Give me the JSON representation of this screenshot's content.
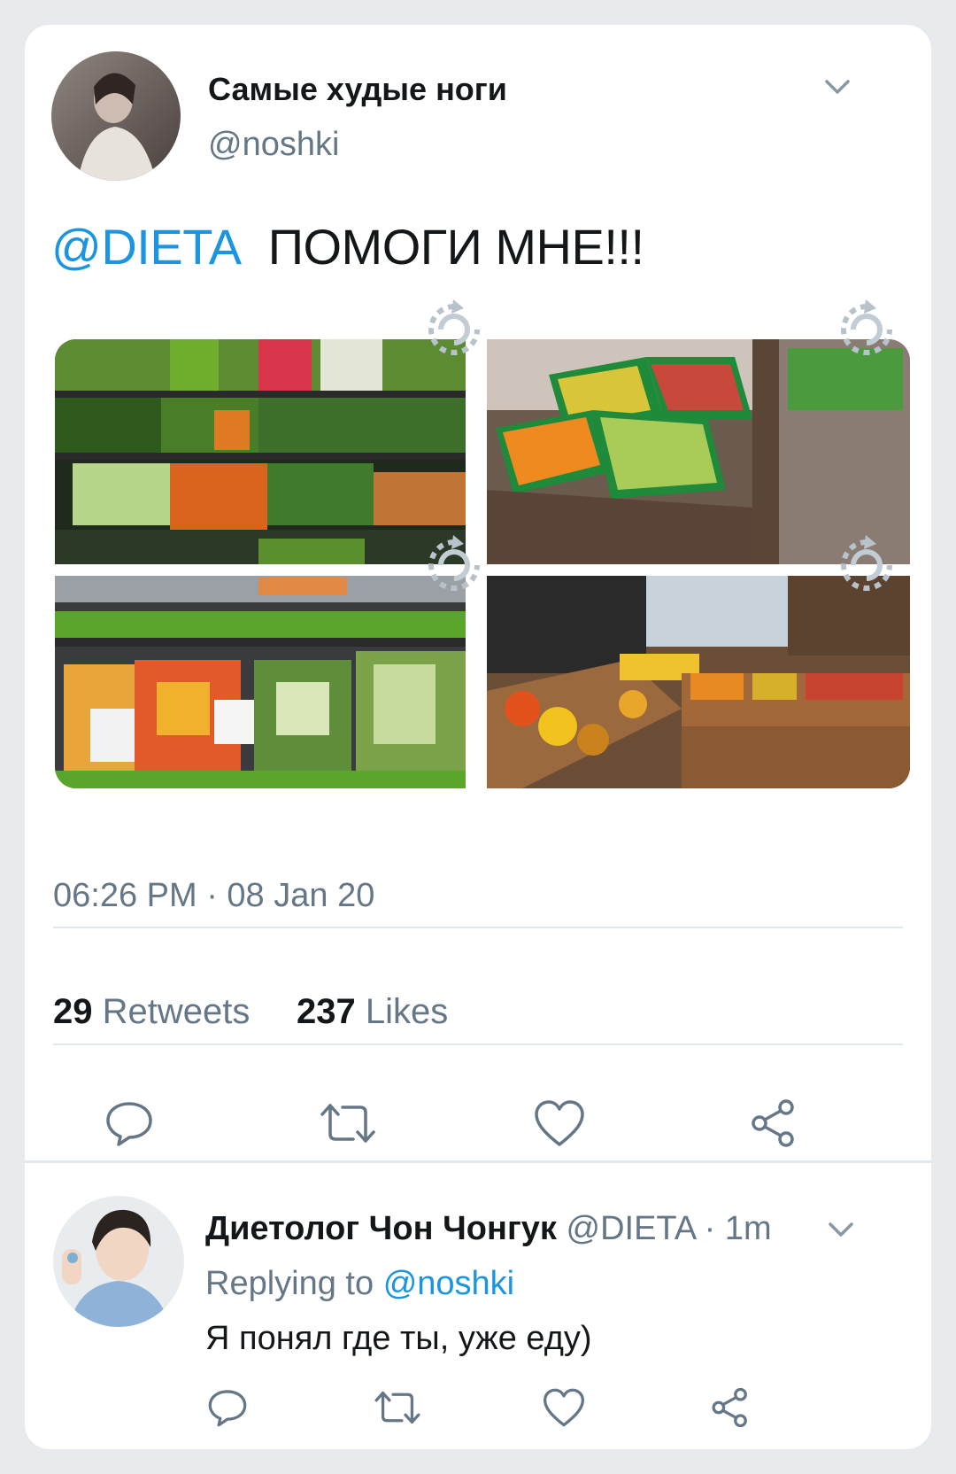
{
  "tweet": {
    "display_name": "Самые худые ноги",
    "handle": "@noshki",
    "mention": "@DIETA",
    "text": "ПОМОГИ МНЕ!!!",
    "timestamp": "06:26 PM · 08 Jan 20",
    "retweets_count": "29",
    "retweets_label": "Retweets",
    "likes_count": "237",
    "likes_label": "Likes",
    "photos": [
      {
        "name": "produce-shelf-photo"
      },
      {
        "name": "fruit-crates-photo"
      },
      {
        "name": "packaged-vegetables-photo"
      },
      {
        "name": "grocery-store-photo"
      }
    ],
    "actions": [
      "reply-icon",
      "retweet-icon",
      "like-icon",
      "share-icon"
    ]
  },
  "reply": {
    "display_name": "Диетолог Чон Чонгук",
    "handle": "@DIETA",
    "time": " · 1m",
    "replying_prefix": "Replying to",
    "replying_to": "@noshki",
    "text": "Я понял где ты, уже еду)",
    "actions": [
      "reply-icon",
      "retweet-icon",
      "like-icon",
      "share-icon"
    ]
  },
  "colors": {
    "accent": "#1b95e0",
    "muted": "#657786",
    "background": "#e9eaee"
  }
}
